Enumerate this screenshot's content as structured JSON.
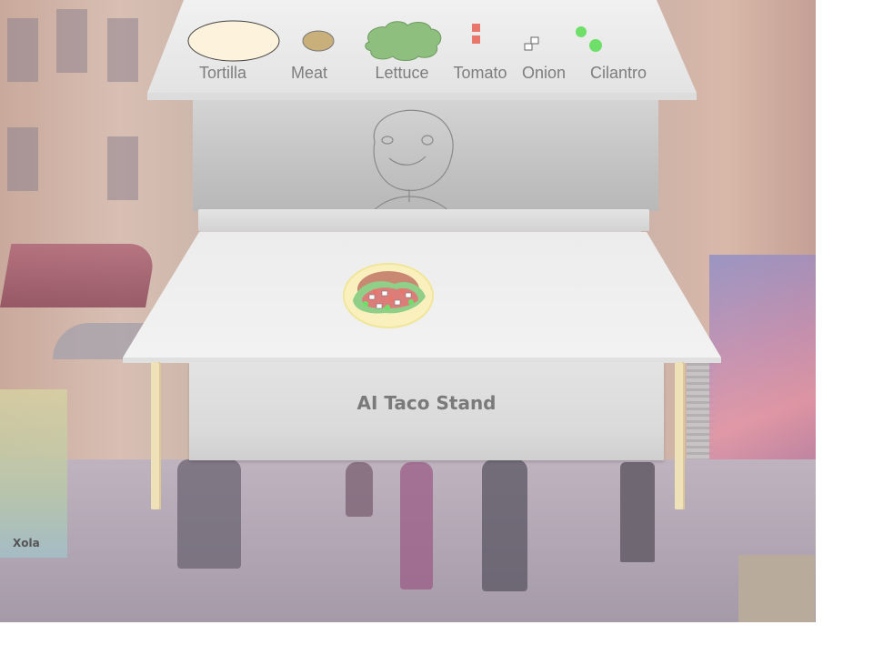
{
  "stand": {
    "title": "AI Taco Stand"
  },
  "ingredients": [
    {
      "id": "tortilla",
      "label": "Tortilla",
      "color": "#fdf3dc"
    },
    {
      "id": "meat",
      "label": "Meat",
      "color": "#c9b07a"
    },
    {
      "id": "lettuce",
      "label": "Lettuce",
      "color": "#8fbf7e"
    },
    {
      "id": "tomato",
      "label": "Tomato",
      "color": "#e8766a"
    },
    {
      "id": "onion",
      "label": "Onion",
      "color": "#ffffff"
    },
    {
      "id": "cilantro",
      "label": "Cilantro",
      "color": "#6ee06a"
    }
  ],
  "background": {
    "sign_text": "Xola"
  }
}
